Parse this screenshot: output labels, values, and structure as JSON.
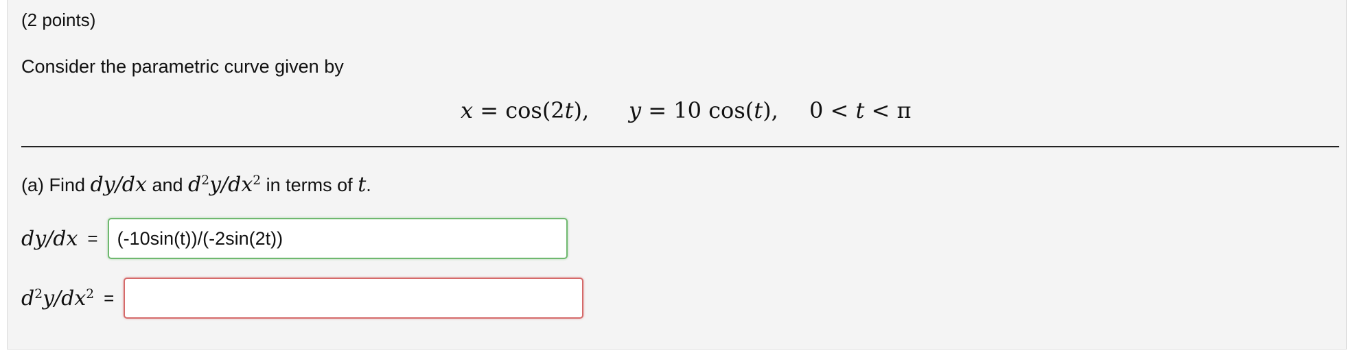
{
  "problem": {
    "points": "(2 points)",
    "intro": "Consider the parametric curve given by",
    "eq_x": {
      "lhs": "x",
      "op": "=",
      "rhs": "cos(2",
      "var": "t",
      "close": "),",
      "full": "x = cos(2t),"
    },
    "eq_y": {
      "lhs": "y",
      "op": "=",
      "coef": "10 cos(",
      "var": "t",
      "close": "),",
      "full": "y = 10 cos(t),"
    },
    "eq_t": {
      "left": "0 <",
      "var": "t",
      "right": "< π",
      "full": "0 < t < π"
    }
  },
  "part_a": {
    "prefix": "(a) Find",
    "d1": "dy/dx",
    "and": "and",
    "d2_base": "d",
    "d2_exp": "2",
    "d2_mid": "y/dx",
    "d2_exp2": "2",
    "suffix": "in terms of",
    "var": "t",
    "period": "."
  },
  "answers": {
    "row1": {
      "label": "dy/dx",
      "equals": "=",
      "value": "(-10sin(t))/(-2sin(2t))",
      "status": "correct"
    },
    "row2": {
      "label_base": "d",
      "label_exp": "2",
      "label_mid": "y/dx",
      "label_exp2": "2",
      "equals": "=",
      "value": "",
      "status": "incorrect"
    }
  },
  "colors": {
    "correct_border": "#6fb86f",
    "incorrect_border": "#d56a6a",
    "panel_bg": "#f4f4f4"
  }
}
